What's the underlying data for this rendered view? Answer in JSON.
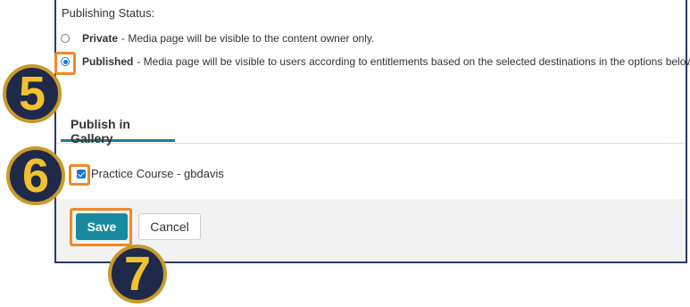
{
  "publishing": {
    "status_label": "Publishing Status:",
    "private": {
      "title": "Private",
      "description": "- Media page will be visible to the content owner only."
    },
    "published": {
      "title": "Published",
      "description": "- Media page will be visible to users according to entitlements based on the selected destinations in the options below."
    }
  },
  "tabs": {
    "active_label": "Publish in Gallery"
  },
  "gallery": {
    "course_label": "Practice Course - gbdavis"
  },
  "footer": {
    "save_label": "Save",
    "cancel_label": "Cancel"
  },
  "annotations": {
    "step5": "5",
    "step6": "6",
    "step7": "7"
  },
  "colors": {
    "accent": "#178aa0",
    "highlight": "#f08a24",
    "badge_bg": "#1f2a4a",
    "badge_text": "#f2c12e"
  }
}
